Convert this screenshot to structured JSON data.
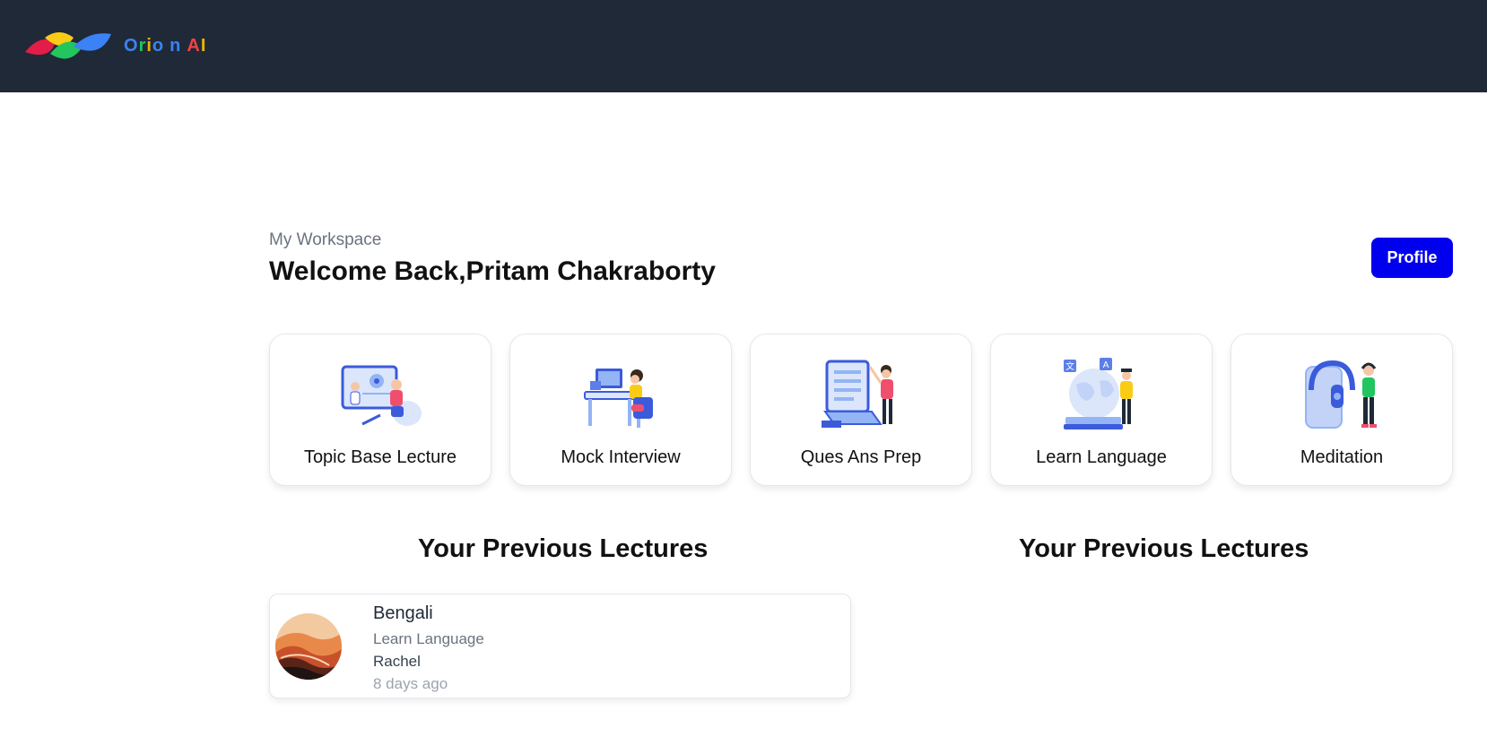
{
  "brand": {
    "name_letters": [
      {
        "ch": "O",
        "color": "#3b82f6"
      },
      {
        "ch": "r",
        "color": "#22c55e"
      },
      {
        "ch": "i",
        "color": "#eab308"
      },
      {
        "ch": "o",
        "color": "#3b82f6"
      },
      {
        "ch": " ",
        "color": "#ffffff"
      },
      {
        "ch": "n",
        "color": "#3b82f6"
      },
      {
        "ch": " ",
        "color": "#ffffff"
      },
      {
        "ch": "A",
        "color": "#ef4444"
      },
      {
        "ch": "I",
        "color": "#eab308"
      }
    ],
    "logo_colors": [
      "#e11d48",
      "#facc15",
      "#22c55e",
      "#3b82f6"
    ]
  },
  "header": {
    "workspace_label": "My Workspace",
    "welcome": "Welcome Back,Pritam Chakraborty",
    "profile_label": "Profile"
  },
  "cards": [
    {
      "title": "Topic Base Lecture",
      "icon": "lecture-illustration"
    },
    {
      "title": "Mock Interview",
      "icon": "interview-illustration"
    },
    {
      "title": "Ques Ans Prep",
      "icon": "quiz-illustration"
    },
    {
      "title": "Learn Language",
      "icon": "language-illustration"
    },
    {
      "title": "Meditation",
      "icon": "meditation-illustration"
    }
  ],
  "sections": {
    "previous_left": "Your Previous Lectures",
    "previous_right": "Your Previous Lectures"
  },
  "lectures": [
    {
      "name": "Bengali",
      "category": "Learn Language",
      "teacher": "Rachel",
      "time": "8 days ago"
    }
  ],
  "colors": {
    "navbar": "#1f2937",
    "accent": "#0000ee"
  }
}
